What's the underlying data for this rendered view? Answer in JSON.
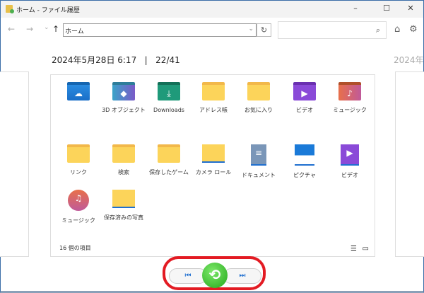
{
  "window": {
    "title": "ホーム - ファイル履歴",
    "minimize": "–",
    "maximize": "☐",
    "close": "✕"
  },
  "toolbar": {
    "back": "←",
    "forward": "→",
    "recent": "⌄",
    "up": "↑",
    "address": "ホーム",
    "dropdown": "⌄",
    "refresh": "↻",
    "search_placeholder": "",
    "search_icon": "⌕",
    "home": "⌂",
    "settings": "⚙"
  },
  "header": {
    "date": "2024年5月28日 6:17",
    "separator": "|",
    "position": "22/41",
    "next_date": "2024年"
  },
  "items": [
    {
      "label": "",
      "icon": "onedrive-folder"
    },
    {
      "label": "3D オブジェクト",
      "icon": "3d-objects-folder"
    },
    {
      "label": "Downloads",
      "icon": "downloads-folder"
    },
    {
      "label": "アドレス帳",
      "icon": "folder"
    },
    {
      "label": "お気に入り",
      "icon": "folder"
    },
    {
      "label": "ビデオ",
      "icon": "videos-folder"
    },
    {
      "label": "ミュージック",
      "icon": "music-folder"
    },
    {
      "label": "リンク",
      "icon": "folder"
    },
    {
      "label": "検索",
      "icon": "folder"
    },
    {
      "label": "保存したゲーム",
      "icon": "folder"
    },
    {
      "label": "カメラ ロール",
      "icon": "camera-roll-library"
    },
    {
      "label": "ドキュメント",
      "icon": "documents-library"
    },
    {
      "label": "ピクチャ",
      "icon": "pictures-library"
    },
    {
      "label": "ビデオ",
      "icon": "videos-library"
    },
    {
      "label": "ミュージック",
      "icon": "music-library"
    },
    {
      "label": "保存済みの写真",
      "icon": "saved-pictures-library"
    }
  ],
  "status": {
    "count": "16 個の項目"
  },
  "controls": {
    "previous": "⏮",
    "restore": "⟲",
    "next": "⏭"
  }
}
